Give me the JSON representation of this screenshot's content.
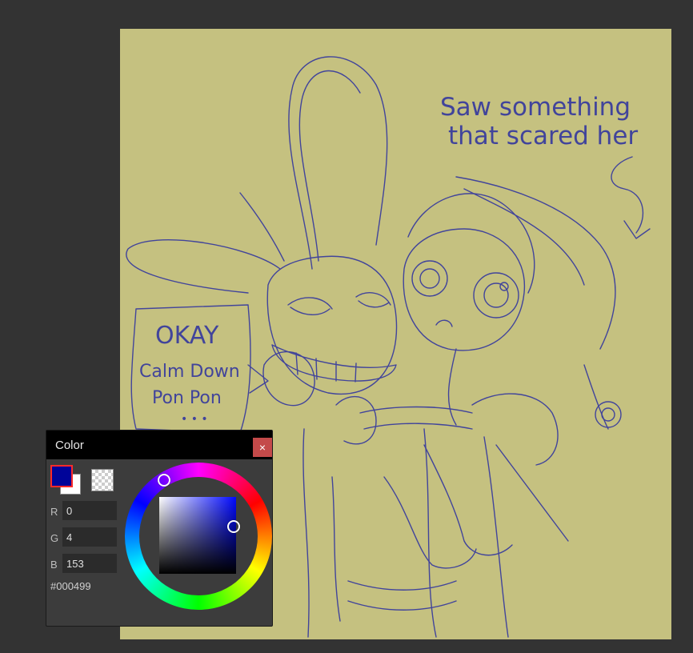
{
  "colors": {
    "workspace_bg": "#333333",
    "canvas_bg": "#c5c180",
    "sketch_stroke": "#2b2fa0",
    "panel_bg": "#3c3c3c",
    "close_button": "#c44a4a",
    "primary_swatch": "#000499",
    "secondary_swatch": "#ffffff"
  },
  "canvas": {
    "caption_line1": "Saw something",
    "caption_line2": "that scared her",
    "bubble_line1": "OKAY",
    "bubble_line2": "Calm Down",
    "bubble_line3": "Pon Pon",
    "bubble_dots": "• • •"
  },
  "color_panel": {
    "title": "Color",
    "close_label": "×",
    "channels": [
      {
        "label": "R",
        "value": "0"
      },
      {
        "label": "G",
        "value": "4"
      },
      {
        "label": "B",
        "value": "153"
      }
    ],
    "hex": "#000499"
  }
}
